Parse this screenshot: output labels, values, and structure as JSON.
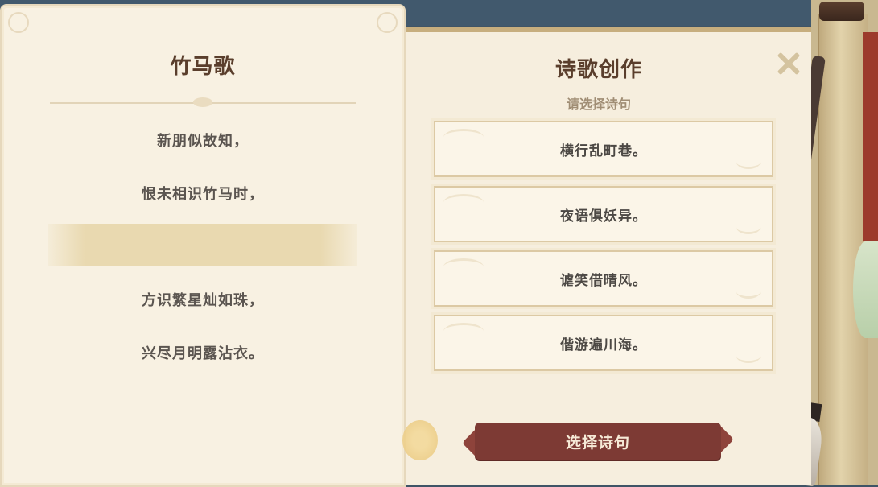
{
  "poem": {
    "title": "竹马歌",
    "lines": [
      "新朋似故知，",
      "恨未相识竹马时，",
      "",
      "方识繁星灿如珠，",
      "兴尽月明露沾衣。"
    ]
  },
  "compose": {
    "title": "诗歌创作",
    "subtitle": "请选择诗句",
    "options": [
      "横行乱町巷。",
      "夜语俱妖异。",
      "谑笑借晴风。",
      "偕游遍川海。"
    ],
    "confirm_label": "选择诗句"
  },
  "colors": {
    "accent": "#7d3a34",
    "title_text": "#5a3e2c",
    "paper": "#f8f1e2"
  },
  "icons": {
    "close": "close-icon"
  }
}
